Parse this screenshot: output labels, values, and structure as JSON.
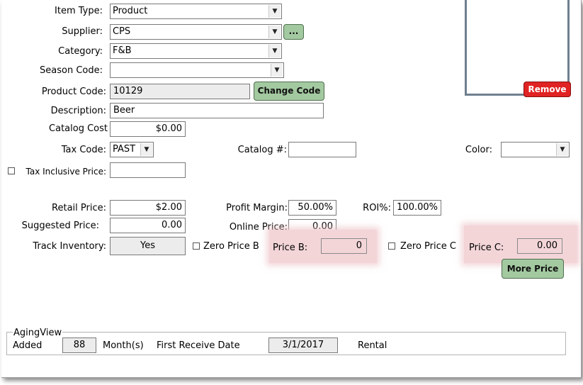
{
  "form": {
    "item_type_label": "Item Type:",
    "item_type_value": "Product",
    "supplier_label": "Supplier:",
    "supplier_value": "CPS",
    "supplier_lookup_label": "...",
    "category_label": "Category:",
    "category_value": "F&B",
    "season_code_label": "Season Code:",
    "season_code_value": "",
    "product_code_label": "Product Code:",
    "product_code_value": "10129",
    "change_code_label": "Change Code",
    "description_label": "Description:",
    "description_value": "Beer",
    "catalog_cost_label": "Catalog Cost",
    "catalog_cost_value": "$0.00",
    "tax_code_label": "Tax Code:",
    "tax_code_value": "PAST",
    "catalog_num_label": "Catalog #:",
    "catalog_num_value": "",
    "color_label": "Color:",
    "color_value": "",
    "tax_inclusive_label": "Tax Inclusive Price:",
    "tax_inclusive_value": "",
    "retail_price_label": "Retail Price:",
    "retail_price_value": "$2.00",
    "profit_margin_label": "Profit Margin:",
    "profit_margin_value": "50.00%",
    "roi_label": "ROI%:",
    "roi_value": "100.00%",
    "suggested_price_label": "Suggested Price:",
    "suggested_price_value": "0.00",
    "online_price_label": "Online Price:",
    "online_price_value": "0.00",
    "track_inventory_label": "Track Inventory:",
    "track_inventory_value": "Yes",
    "zero_price_b_label": "Zero Price B",
    "price_b_label": "Price B:",
    "price_b_value": "0",
    "zero_price_c_label": "Zero Price C",
    "price_c_label": "Price C:",
    "price_c_value": "0.00",
    "more_price_label": "More Price",
    "remove_label": "Remove"
  },
  "aging_view": {
    "title": "AgingView",
    "added_label": "Added",
    "added_value": "88",
    "months_label": "Month(s)",
    "first_receive_label": "First Receive Date",
    "first_receive_value": "3/1/2017",
    "rental_label": "Rental"
  },
  "colors": {
    "green_button": "#a3c9a0",
    "red_button": "#e02323",
    "highlight_pink": "#f3d5d8",
    "image_frame": "#6f7f8f"
  },
  "icons": {
    "dropdown": "chevron-down-icon"
  }
}
